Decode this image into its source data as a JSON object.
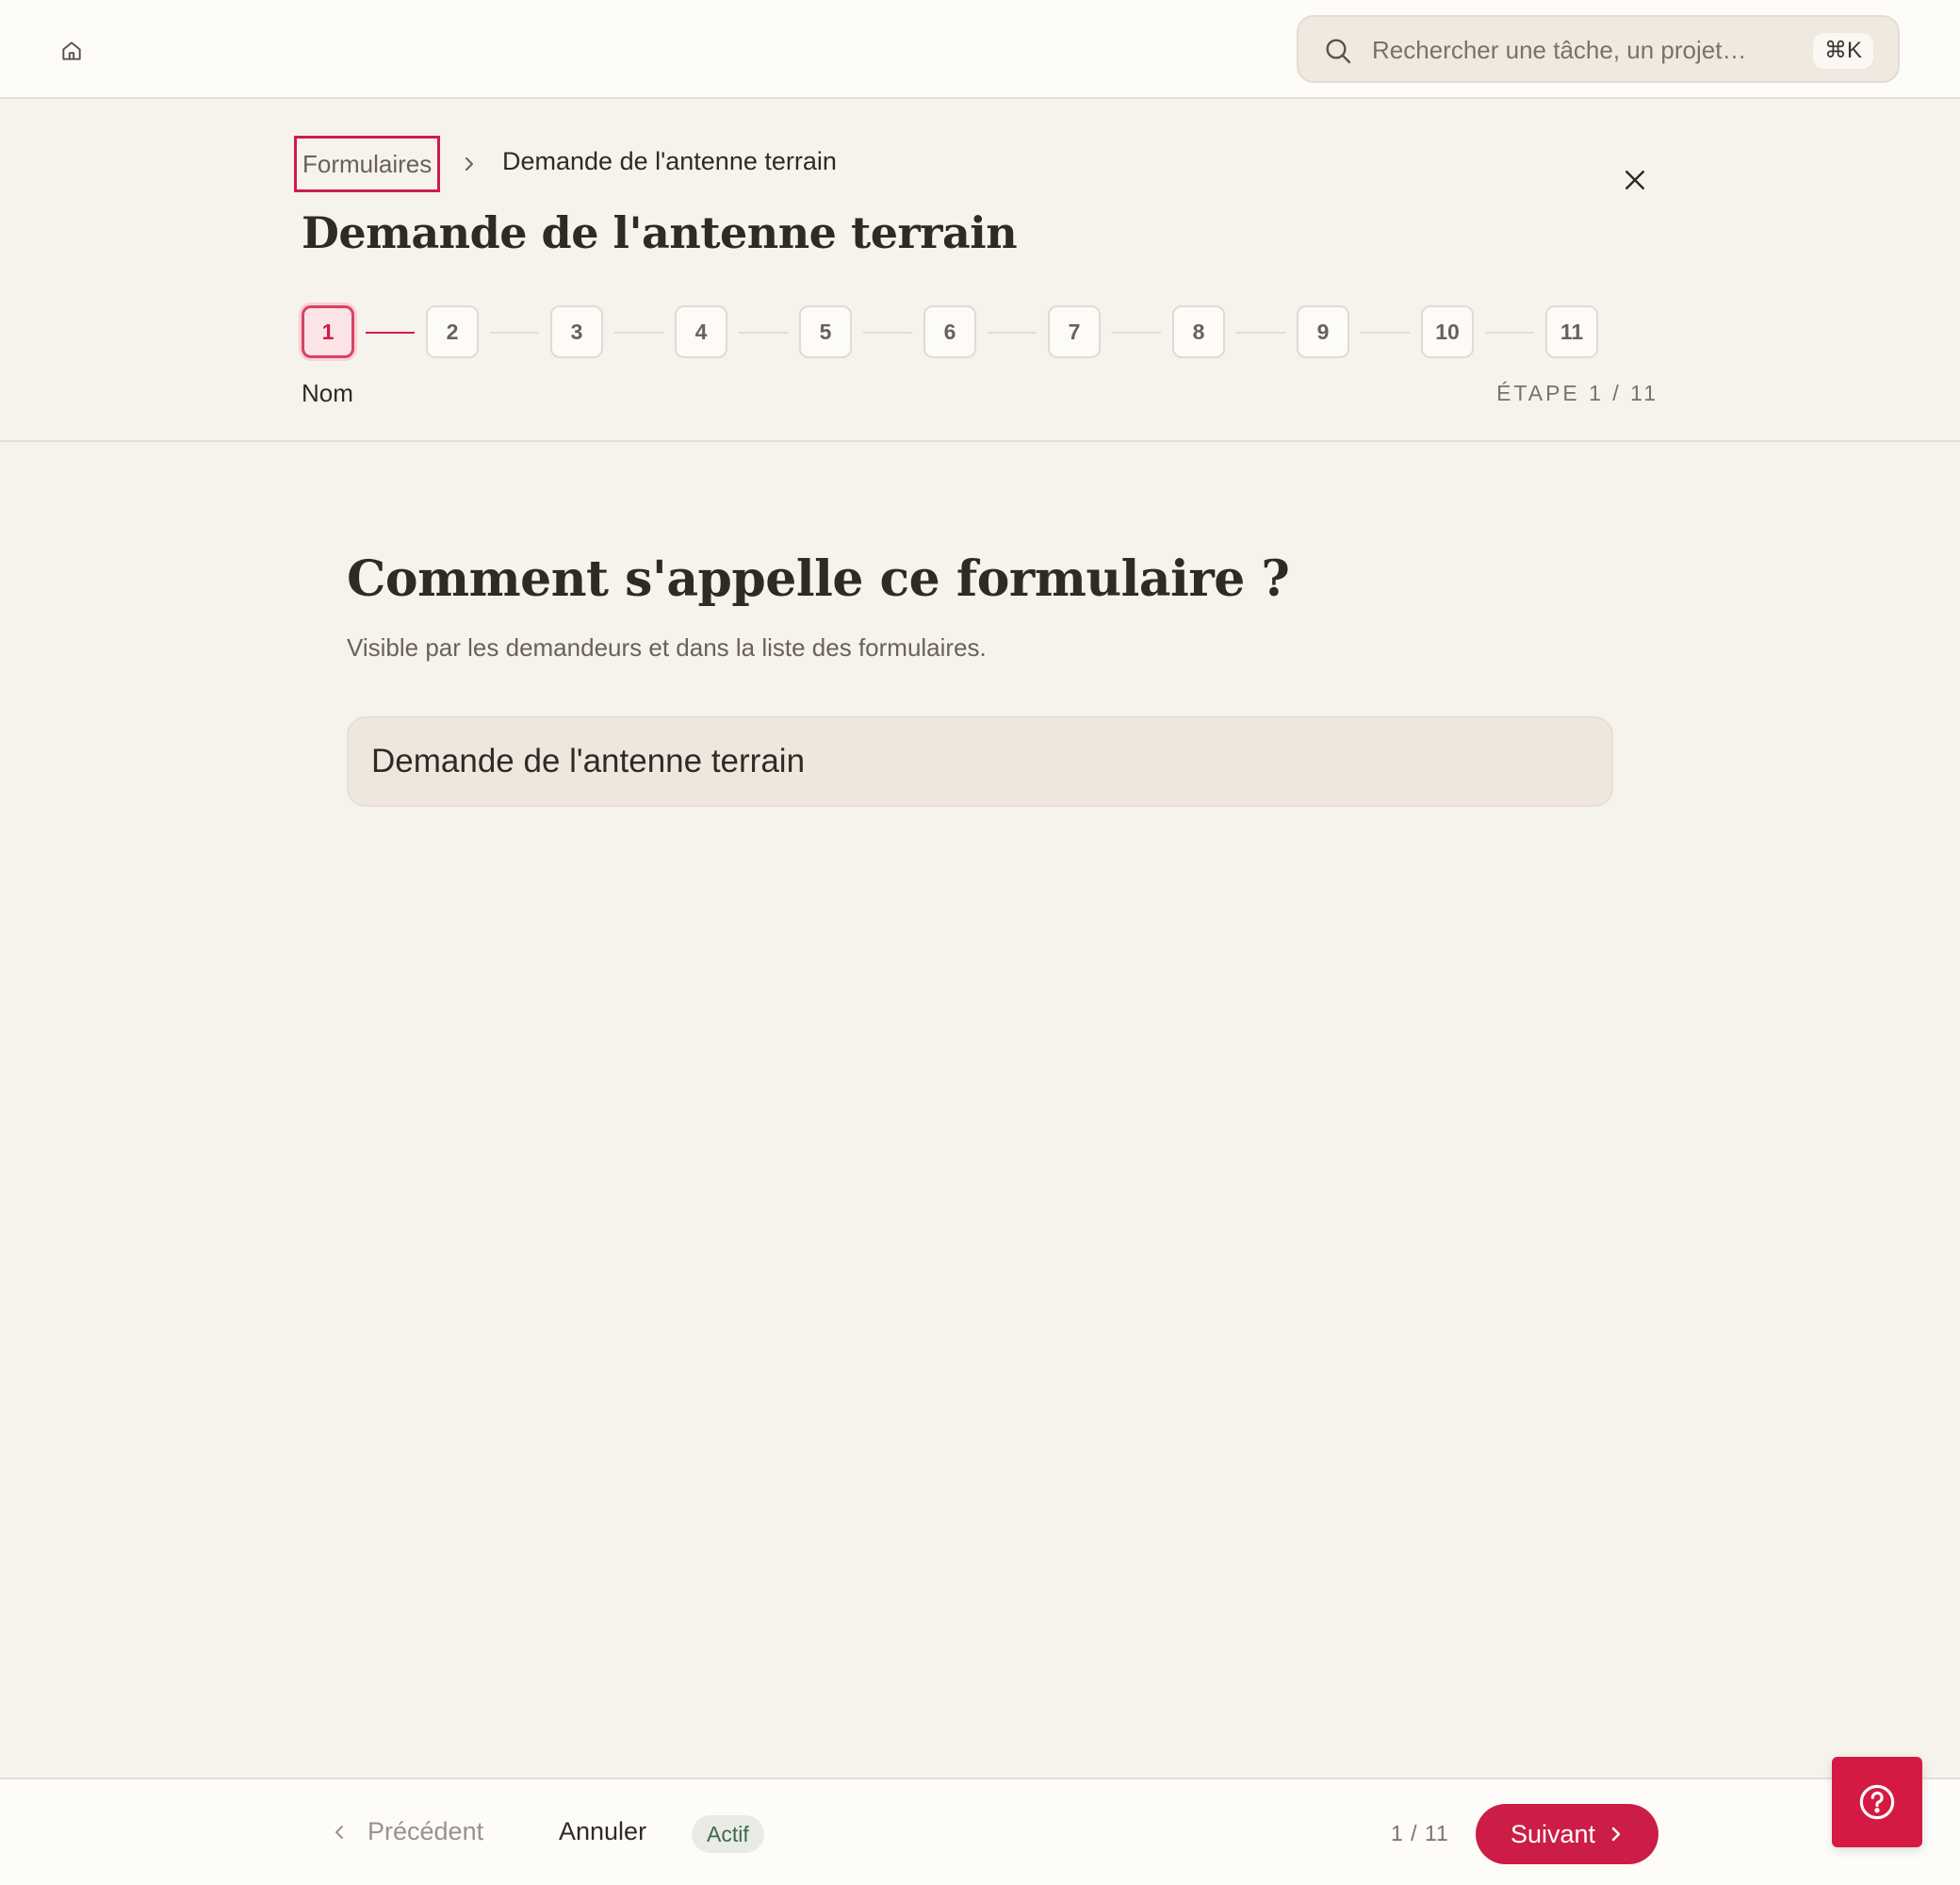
{
  "topbar": {
    "search_placeholder": "Rechercher une tâche, un projet…",
    "search_shortcut": "⌘K"
  },
  "breadcrumb": {
    "parent": "Formulaires",
    "current": "Demande de l'antenne terrain"
  },
  "header": {
    "title": "Demande de l'antenne terrain"
  },
  "stepper": {
    "steps": [
      "1",
      "2",
      "3",
      "4",
      "5",
      "6",
      "7",
      "8",
      "9",
      "10",
      "11"
    ],
    "current_label": "Nom",
    "count_text": "ÉTAPE 1 / 11"
  },
  "question": {
    "title": "Comment s'appelle ce formulaire ?",
    "subtitle": "Visible par les demandeurs et dans la liste des formulaires.",
    "input_value": "Demande de l'antenne terrain"
  },
  "footer": {
    "prev_label": "Précédent",
    "cancel_label": "Annuler",
    "status_badge": "Actif",
    "page_count": "1 / 11",
    "next_label": "Suivant"
  },
  "colors": {
    "accent": "#cc1d47",
    "background": "#f6f2ec",
    "status_green": "#3f6a48"
  },
  "icons": [
    "home-icon",
    "search-icon",
    "chevron-right-icon",
    "close-icon",
    "chevron-left-icon",
    "help-icon"
  ]
}
